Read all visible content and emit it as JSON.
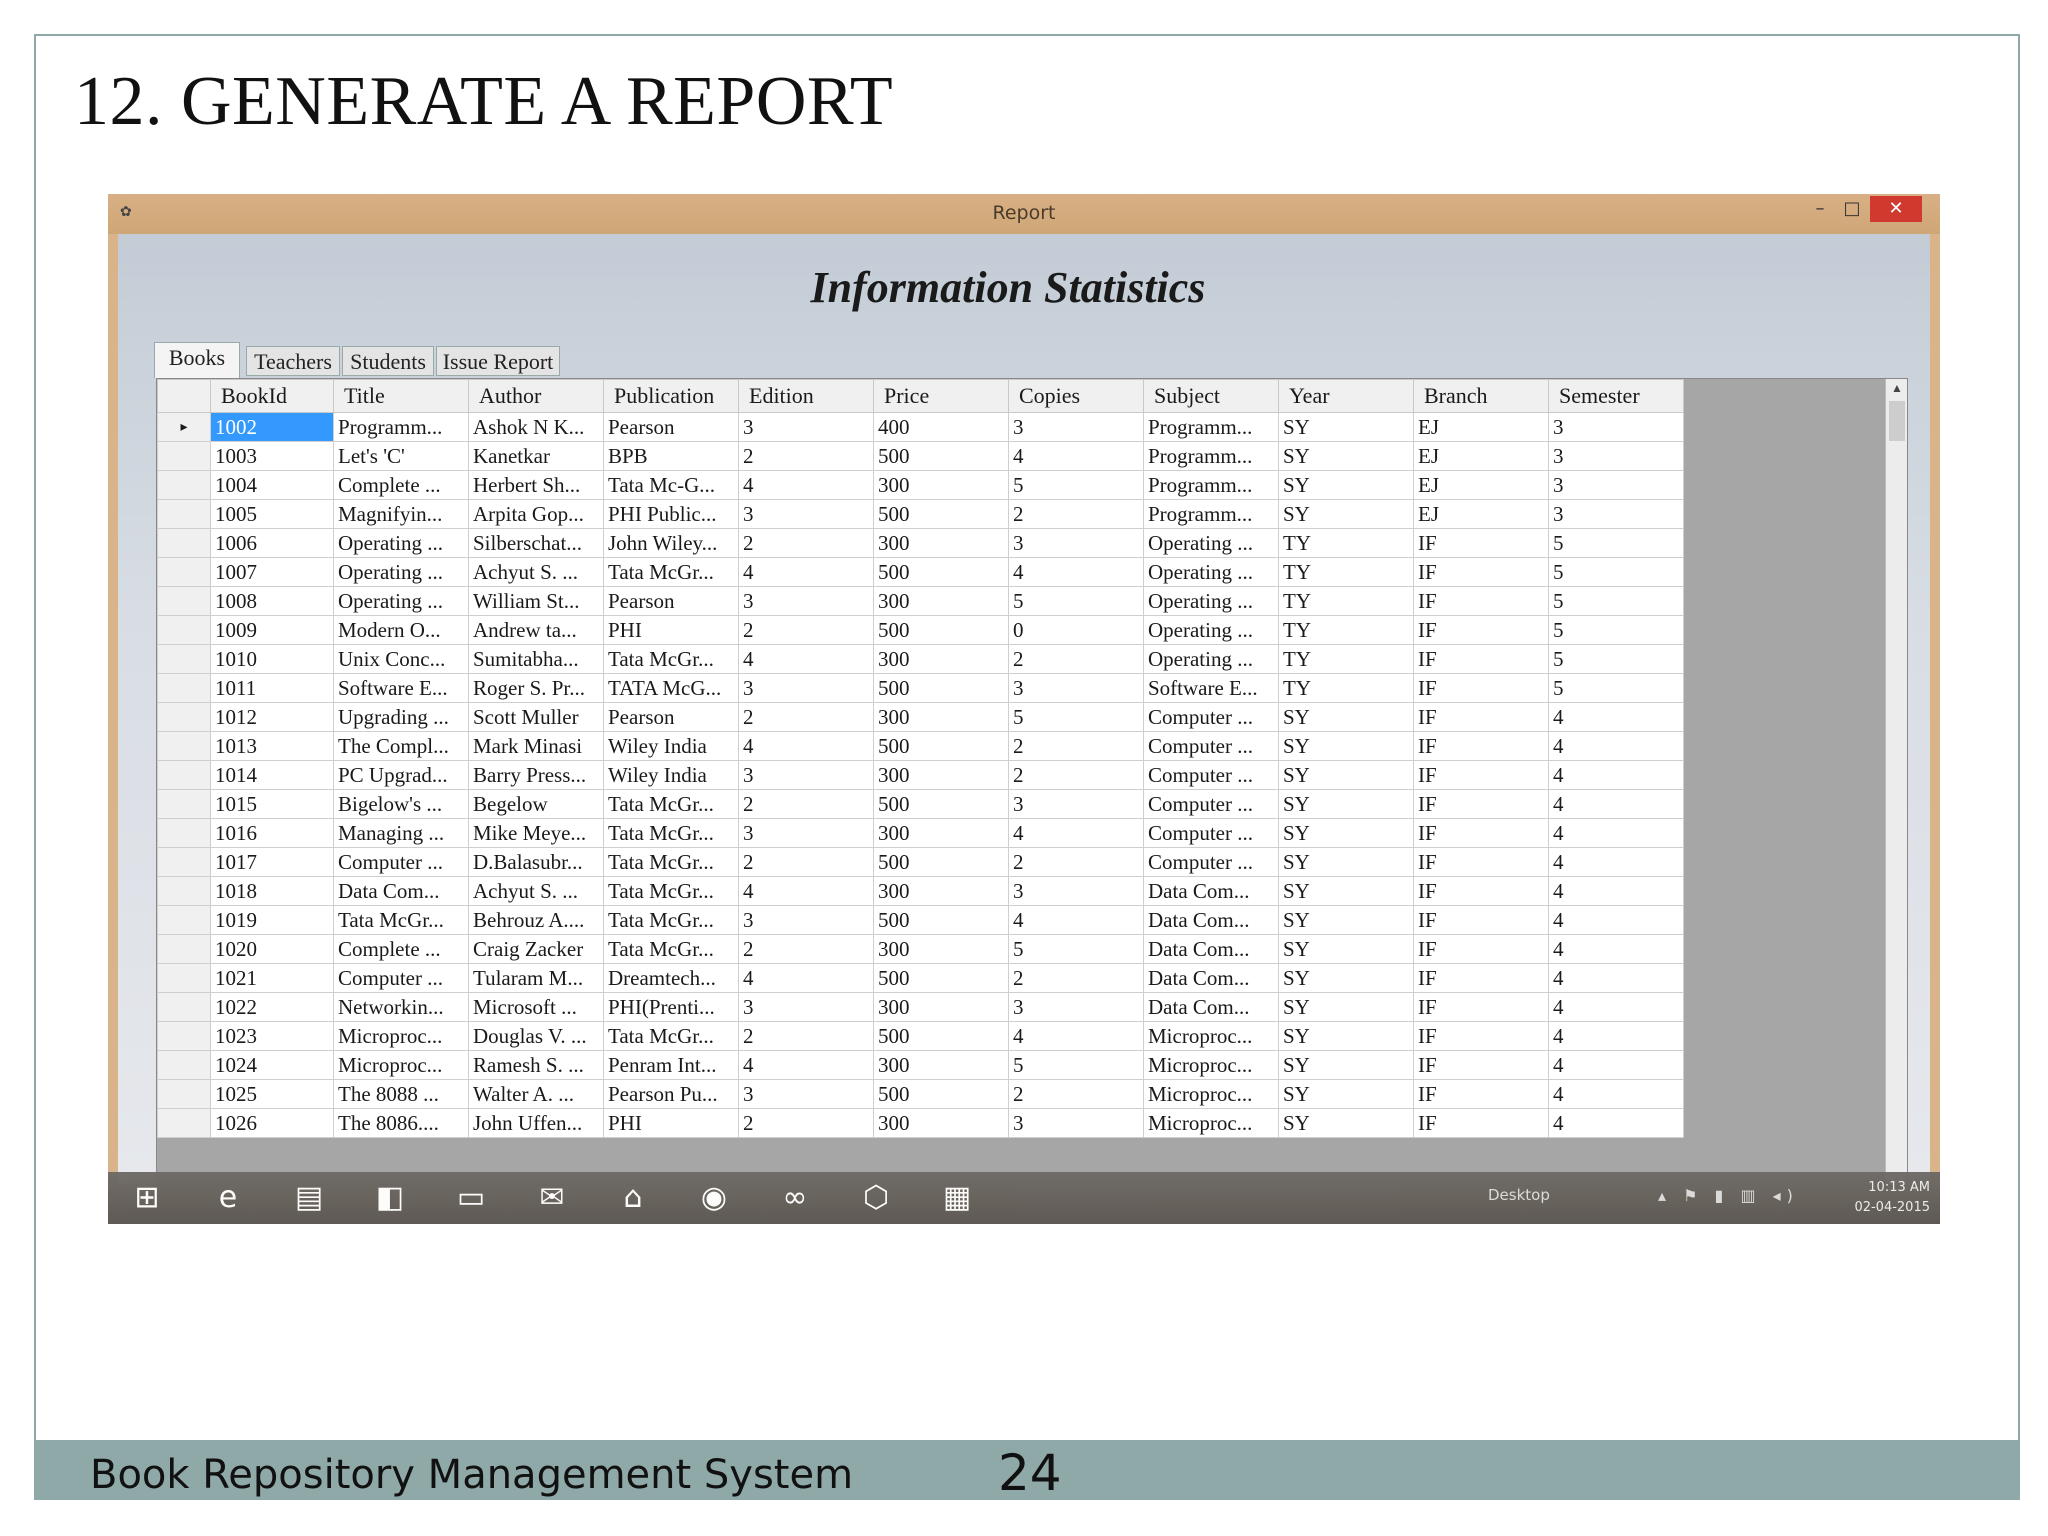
{
  "slide": {
    "title": "12. GENERATE A REPORT",
    "footer_left": "Book Repository Management System",
    "page_number": "24"
  },
  "window": {
    "title": "Report",
    "min_glyph": "–",
    "max_glyph": "□",
    "close_glyph": "✕",
    "heading": "Information Statistics"
  },
  "tabs": [
    {
      "label": "Books",
      "active": true
    },
    {
      "label": "Teachers",
      "active": false
    },
    {
      "label": "Students",
      "active": false
    },
    {
      "label": "Issue Report",
      "active": false
    }
  ],
  "grid": {
    "columns": [
      "BookId",
      "Title",
      "Author",
      "Publication",
      "Edition",
      "Price",
      "Copies",
      "Subject",
      "Year",
      "Branch",
      "Semester"
    ],
    "selected_row": 0,
    "row_indicator": "▸",
    "rows": [
      [
        "1002",
        "Programm...",
        "Ashok N K...",
        "Pearson",
        "3",
        "400",
        "3",
        "Programm...",
        "SY",
        "EJ",
        "3"
      ],
      [
        "1003",
        "Let's 'C'",
        "Kanetkar",
        "BPB",
        "2",
        "500",
        "4",
        "Programm...",
        "SY",
        "EJ",
        "3"
      ],
      [
        "1004",
        "Complete ...",
        "Herbert Sh...",
        "Tata Mc-G...",
        "4",
        "300",
        "5",
        "Programm...",
        "SY",
        "EJ",
        "3"
      ],
      [
        "1005",
        "Magnifyin...",
        "Arpita Gop...",
        "PHI Public...",
        "3",
        "500",
        "2",
        "Programm...",
        "SY",
        "EJ",
        "3"
      ],
      [
        "1006",
        "Operating ...",
        "Silberschat...",
        "John Wiley...",
        "2",
        "300",
        "3",
        "Operating ...",
        "TY",
        "IF",
        "5"
      ],
      [
        "1007",
        "Operating ...",
        "Achyut S. ...",
        "Tata McGr...",
        "4",
        "500",
        "4",
        "Operating ...",
        "TY",
        "IF",
        "5"
      ],
      [
        "1008",
        "Operating ...",
        "William St...",
        "Pearson",
        "3",
        "300",
        "5",
        "Operating ...",
        "TY",
        "IF",
        "5"
      ],
      [
        "1009",
        "Modern O...",
        "Andrew ta...",
        "PHI",
        "2",
        "500",
        "0",
        "Operating ...",
        "TY",
        "IF",
        "5"
      ],
      [
        "1010",
        "Unix Conc...",
        "Sumitabha...",
        "Tata McGr...",
        "4",
        "300",
        "2",
        "Operating ...",
        "TY",
        "IF",
        "5"
      ],
      [
        "1011",
        "Software E...",
        "Roger S. Pr...",
        "TATA McG...",
        "3",
        "500",
        "3",
        "Software E...",
        "TY",
        "IF",
        "5"
      ],
      [
        "1012",
        "Upgrading ...",
        "Scott Muller",
        "Pearson",
        "2",
        "300",
        "5",
        "Computer ...",
        "SY",
        "IF",
        "4"
      ],
      [
        "1013",
        "The Compl...",
        "Mark Minasi",
        "Wiley India",
        "4",
        "500",
        "2",
        "Computer ...",
        "SY",
        "IF",
        "4"
      ],
      [
        "1014",
        "PC Upgrad...",
        "Barry Press...",
        "Wiley India",
        "3",
        "300",
        "2",
        "Computer ...",
        "SY",
        "IF",
        "4"
      ],
      [
        "1015",
        "Bigelow's ...",
        "Begelow",
        "Tata McGr...",
        "2",
        "500",
        "3",
        "Computer ...",
        "SY",
        "IF",
        "4"
      ],
      [
        "1016",
        "Managing ...",
        "Mike Meye...",
        "Tata McGr...",
        "3",
        "300",
        "4",
        "Computer ...",
        "SY",
        "IF",
        "4"
      ],
      [
        "1017",
        "Computer ...",
        "D.Balasubr...",
        "Tata McGr...",
        "2",
        "500",
        "2",
        "Computer ...",
        "SY",
        "IF",
        "4"
      ],
      [
        "1018",
        "Data Com...",
        "Achyut S. ...",
        "Tata McGr...",
        "4",
        "300",
        "3",
        "Data Com...",
        "SY",
        "IF",
        "4"
      ],
      [
        "1019",
        "Tata McGr...",
        "Behrouz A....",
        "Tata McGr...",
        "3",
        "500",
        "4",
        "Data Com...",
        "SY",
        "IF",
        "4"
      ],
      [
        "1020",
        "Complete ...",
        "Craig Zacker",
        "Tata McGr...",
        "2",
        "300",
        "5",
        "Data Com...",
        "SY",
        "IF",
        "4"
      ],
      [
        "1021",
        "Computer ...",
        "Tularam M...",
        "Dreamtech...",
        "4",
        "500",
        "2",
        "Data Com...",
        "SY",
        "IF",
        "4"
      ],
      [
        "1022",
        "Networkin...",
        "Microsoft ...",
        "PHI(Prenti...",
        "3",
        "300",
        "3",
        "Data Com...",
        "SY",
        "IF",
        "4"
      ],
      [
        "1023",
        "Microproc...",
        "Douglas V. ...",
        "Tata McGr...",
        "2",
        "500",
        "4",
        "Microproc...",
        "SY",
        "IF",
        "4"
      ],
      [
        "1024",
        "Microproc...",
        "Ramesh S. ...",
        "Penram Int...",
        "4",
        "300",
        "5",
        "Microproc...",
        "SY",
        "IF",
        "4"
      ],
      [
        "1025",
        "The 8088 ...",
        "Walter A. ...",
        "Pearson Pu...",
        "3",
        "500",
        "2",
        "Microproc...",
        "SY",
        "IF",
        "4"
      ],
      [
        "1026",
        "The 8086....",
        "John Uffen...",
        "PHI",
        "2",
        "300",
        "3",
        "Microproc...",
        "SY",
        "IF",
        "4"
      ]
    ]
  },
  "taskbar": {
    "items": [
      {
        "name": "start-icon",
        "glyph": "⊞"
      },
      {
        "name": "internet-explorer-icon",
        "glyph": "e"
      },
      {
        "name": "file-explorer-icon",
        "glyph": "▤"
      },
      {
        "name": "store-icon",
        "glyph": "◧"
      },
      {
        "name": "computer-icon",
        "glyph": "▭"
      },
      {
        "name": "mail-icon",
        "glyph": "✉"
      },
      {
        "name": "home-icon",
        "glyph": "⌂"
      },
      {
        "name": "chrome-icon",
        "glyph": "◉"
      },
      {
        "name": "media-icon",
        "glyph": "∞"
      },
      {
        "name": "box-icon",
        "glyph": "⬡"
      },
      {
        "name": "app-window-icon",
        "glyph": "▦"
      }
    ],
    "desktop_label": "Desktop",
    "tray_glyphs": "▴ ⚑ ▮ ▥ ◂)",
    "clock_time": "10:13 AM",
    "clock_date": "02-04-2015"
  }
}
